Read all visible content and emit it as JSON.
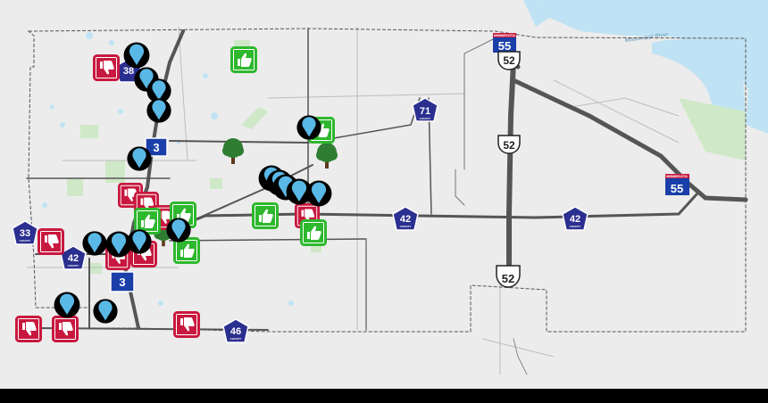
{
  "map": {
    "water_label": "Mississippi River",
    "route_labels": {
      "i55_north": "55",
      "i55_east": "55",
      "us52_north": "52",
      "us52_mid": "52",
      "us52_south": "52",
      "cr71": "71",
      "cr42_center": "42",
      "cr42_east": "42",
      "cr42_west": "42",
      "cr46": "46",
      "cr33": "33",
      "sh3_north": "3",
      "sh3_south": "3",
      "cr38": "38"
    },
    "shield_county_text": "COUNTY",
    "shield_state_text": "MINNESOTA",
    "marker_types": {
      "pin": "location-pin-icon",
      "thumbs_up": "thumbs-up-icon",
      "thumbs_down": "thumbs-down-icon",
      "tree": "tree-icon"
    },
    "colors": {
      "background": "#ececec",
      "water": "#bfe3f4",
      "park": "#cfe8c8",
      "major_road": "#555555",
      "minor_road": "#777777",
      "boundary": "#555555",
      "pin_fill": "#5ab8e6",
      "pin_outline": "#000000",
      "thumbs_up": "#2db82d",
      "thumbs_down": "#c8183f",
      "tree": "#2e7d32",
      "interstate": "#1a3fa8",
      "county_shield": "#2b2f8f",
      "bottom_bar": "#000000"
    }
  }
}
